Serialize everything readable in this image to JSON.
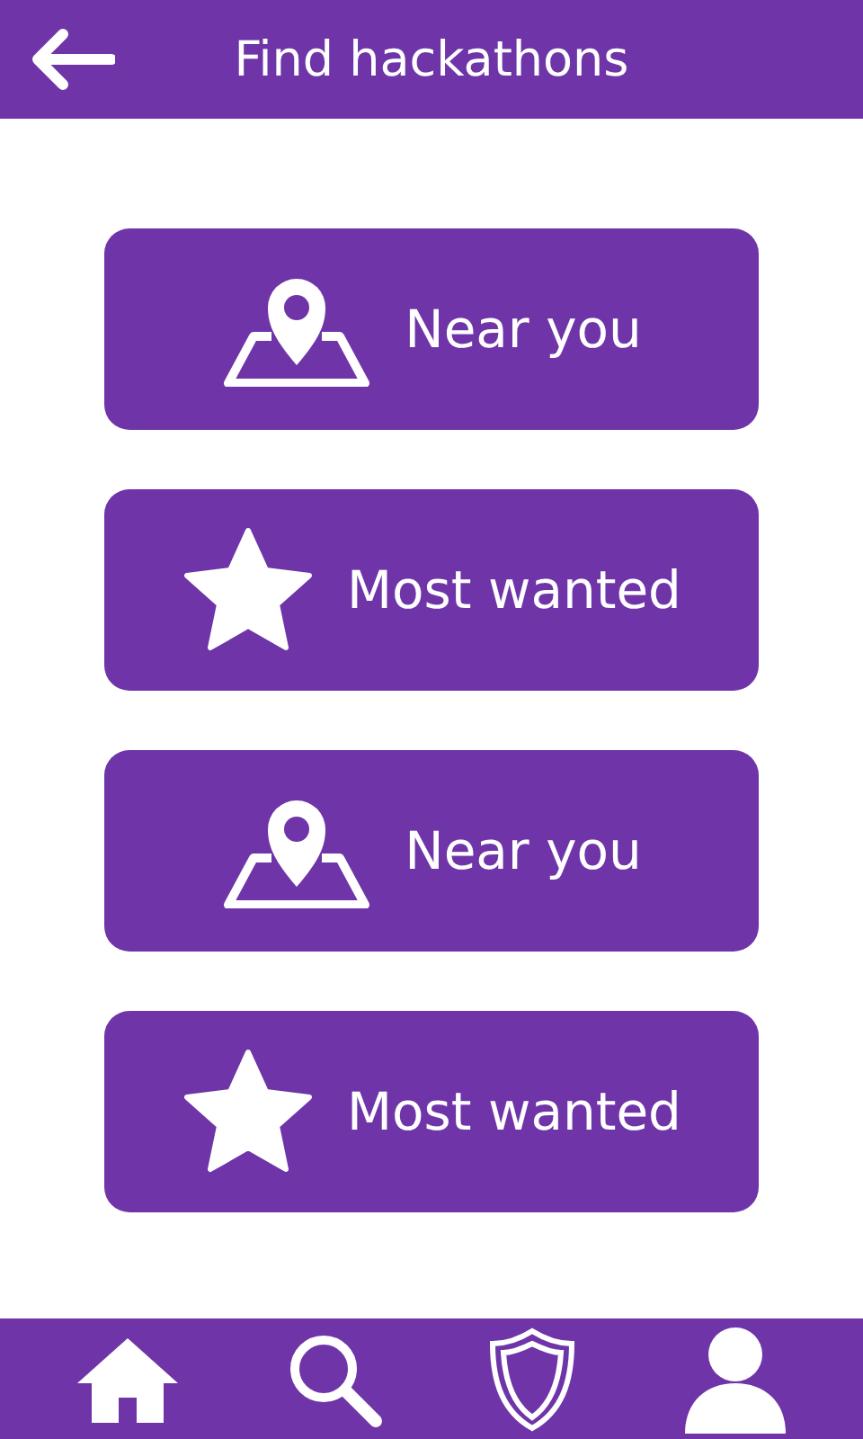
{
  "header": {
    "title": "Find hackathons"
  },
  "options": [
    {
      "kind": "location",
      "label": "Near you"
    },
    {
      "kind": "star",
      "label": "Most wanted"
    },
    {
      "kind": "location",
      "label": "Near you"
    },
    {
      "kind": "star",
      "label": "Most wanted"
    }
  ],
  "nav": [
    {
      "kind": "home"
    },
    {
      "kind": "search"
    },
    {
      "kind": "shield"
    },
    {
      "kind": "profile"
    }
  ]
}
